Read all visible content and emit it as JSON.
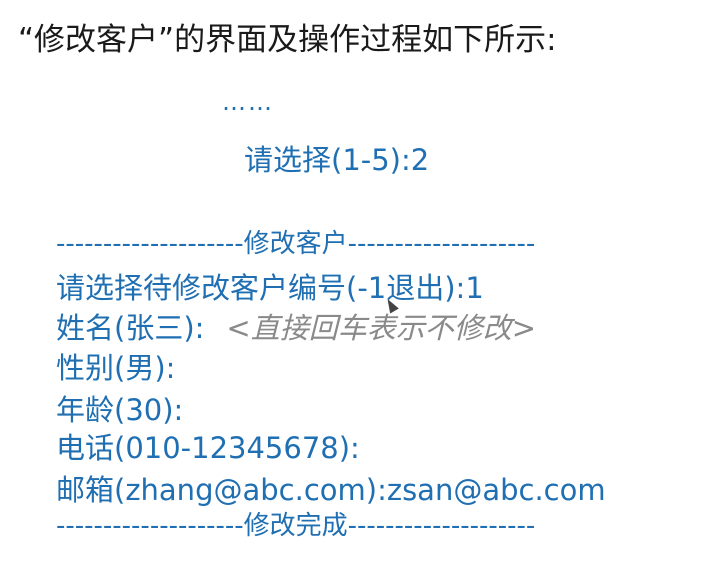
{
  "heading": "“修改客户”的界面及操作过程如下所示:",
  "console": {
    "ellipsis": "……",
    "menu_choice": "请选择(1-5):2",
    "divider_top": "--------------------修改客户--------------------",
    "prompts": [
      {
        "label": "请选择待修改客户编号(-1退出):",
        "value": "1"
      },
      {
        "label": "姓名(张三):",
        "hint": "<直接回车表示不修改>"
      },
      {
        "label": "性别(男):"
      },
      {
        "label": "年龄(30):"
      },
      {
        "label": "电话(010-12345678):"
      },
      {
        "label": "邮箱(zhang@abc.com):",
        "value": "zsan@abc.com"
      }
    ],
    "divider_bottom": "--------------------修改完成--------------------"
  },
  "colors": {
    "console_text": "#1f6fb2",
    "hint_text": "#8a8a8a",
    "heading_text": "#1a1a1a"
  },
  "icons": {
    "mouse_cursor": "mouse-cursor-icon"
  }
}
